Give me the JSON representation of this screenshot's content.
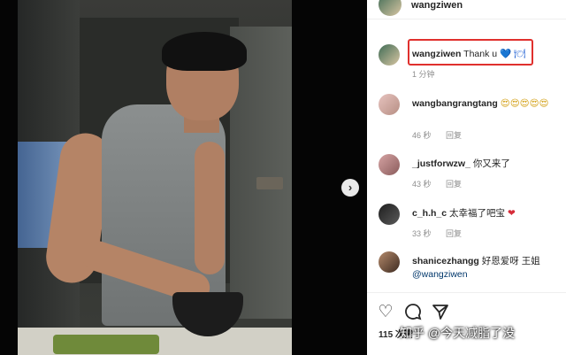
{
  "post": {
    "username": "wangziwen"
  },
  "comments": [
    {
      "username": "wangziwen",
      "text": "Thank u",
      "suffix": "💙 🍽",
      "time": "1 分钟",
      "reply": ""
    },
    {
      "username": "wangbangrangtang",
      "text": "😍😍😍😍😍",
      "time": "46 秒",
      "reply": "回复"
    },
    {
      "username": "_justforwzw_",
      "text": "你又来了",
      "time": "43 秒",
      "reply": "回复"
    },
    {
      "username": "c_h.h_c",
      "text": "太幸福了吧宝",
      "suffix": "❤",
      "time": "33 秒",
      "reply": "回复"
    },
    {
      "username": "shanicezhangg",
      "text": "好恩爱呀 王姐",
      "mention": "@wangziwen",
      "time": "",
      "reply": ""
    }
  ],
  "actions": {
    "like_icon": "heart-outline-icon",
    "comment_icon": "comment-bubble-icon",
    "share_icon": "paper-plane-icon",
    "likes_count": "115 次赞"
  },
  "media": {
    "next_label": "›"
  },
  "watermark": "知乎 @今天减脂了没",
  "colors": {
    "highlight_border": "#e0302d",
    "meta_gray": "#8e8e8e",
    "mention_blue": "#00376b"
  }
}
